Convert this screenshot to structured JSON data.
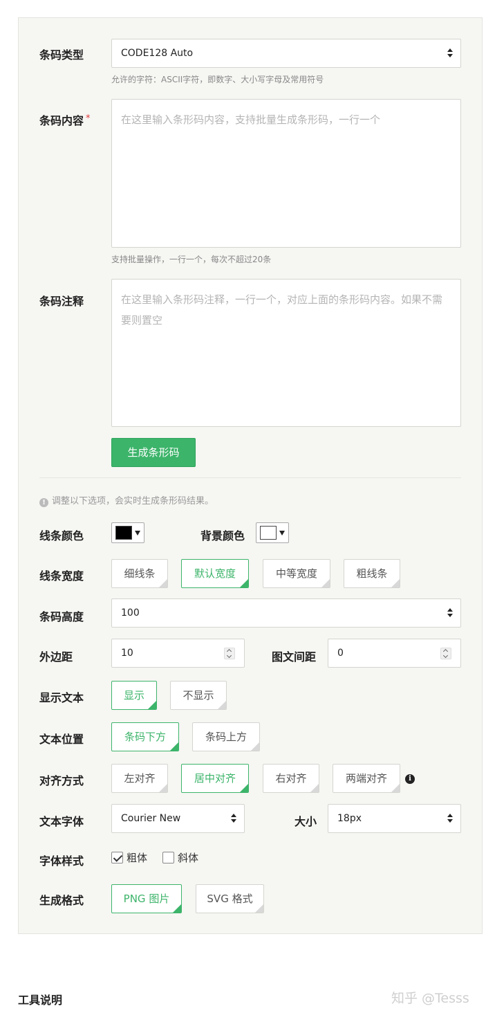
{
  "form": {
    "barcode_type": {
      "label": "条码类型",
      "value": "CODE128 Auto",
      "help": "允许的字符：ASCII字符，即数字、大小写字母及常用符号"
    },
    "barcode_content": {
      "label": "条码内容",
      "required_mark": "*",
      "placeholder": "在这里输入条形码内容，支持批量生成条形码，一行一个",
      "help": "支持批量操作，一行一个，每次不超过20条"
    },
    "barcode_note": {
      "label": "条码注释",
      "placeholder": "在这里输入条形码注释，一行一个，对应上面的条形码内容。如果不需要则置空"
    },
    "generate_button": "生成条形码",
    "tip": "调整以下选项，会实时生成条形码结果。"
  },
  "options": {
    "line_color": {
      "label": "线条颜色",
      "value": "#000000"
    },
    "bg_color": {
      "label": "背景颜色",
      "value": "#ffffff"
    },
    "line_width": {
      "label": "线条宽度",
      "choices": [
        "细线条",
        "默认宽度",
        "中等宽度",
        "粗线条"
      ],
      "selected": "默认宽度"
    },
    "barcode_height": {
      "label": "条码高度",
      "value": "100"
    },
    "margin": {
      "label": "外边距",
      "value": "10"
    },
    "text_gap": {
      "label": "图文间距",
      "value": "0"
    },
    "show_text": {
      "label": "显示文本",
      "choices": [
        "显示",
        "不显示"
      ],
      "selected": "显示"
    },
    "text_position": {
      "label": "文本位置",
      "choices": [
        "条码下方",
        "条码上方"
      ],
      "selected": "条码下方"
    },
    "alignment": {
      "label": "对齐方式",
      "choices": [
        "左对齐",
        "居中对齐",
        "右对齐",
        "两端对齐"
      ],
      "selected": "居中对齐",
      "info_icon": "info-icon"
    },
    "font": {
      "label": "文本字体",
      "value": "Courier New"
    },
    "size": {
      "label": "大小",
      "value": "18px"
    },
    "font_style": {
      "label": "字体样式",
      "bold": {
        "label": "粗体",
        "checked": true
      },
      "italic": {
        "label": "斜体",
        "checked": false
      }
    },
    "output_format": {
      "label": "生成格式",
      "choices": [
        "PNG 图片",
        "SVG 格式"
      ],
      "selected": "PNG 图片"
    }
  },
  "footer": {
    "section_title": "工具说明",
    "watermark": "知乎 @Tesss"
  },
  "colors": {
    "accent": "#3cb46a",
    "panel_bg": "#f6f6f3",
    "required": "#e03a3a"
  }
}
